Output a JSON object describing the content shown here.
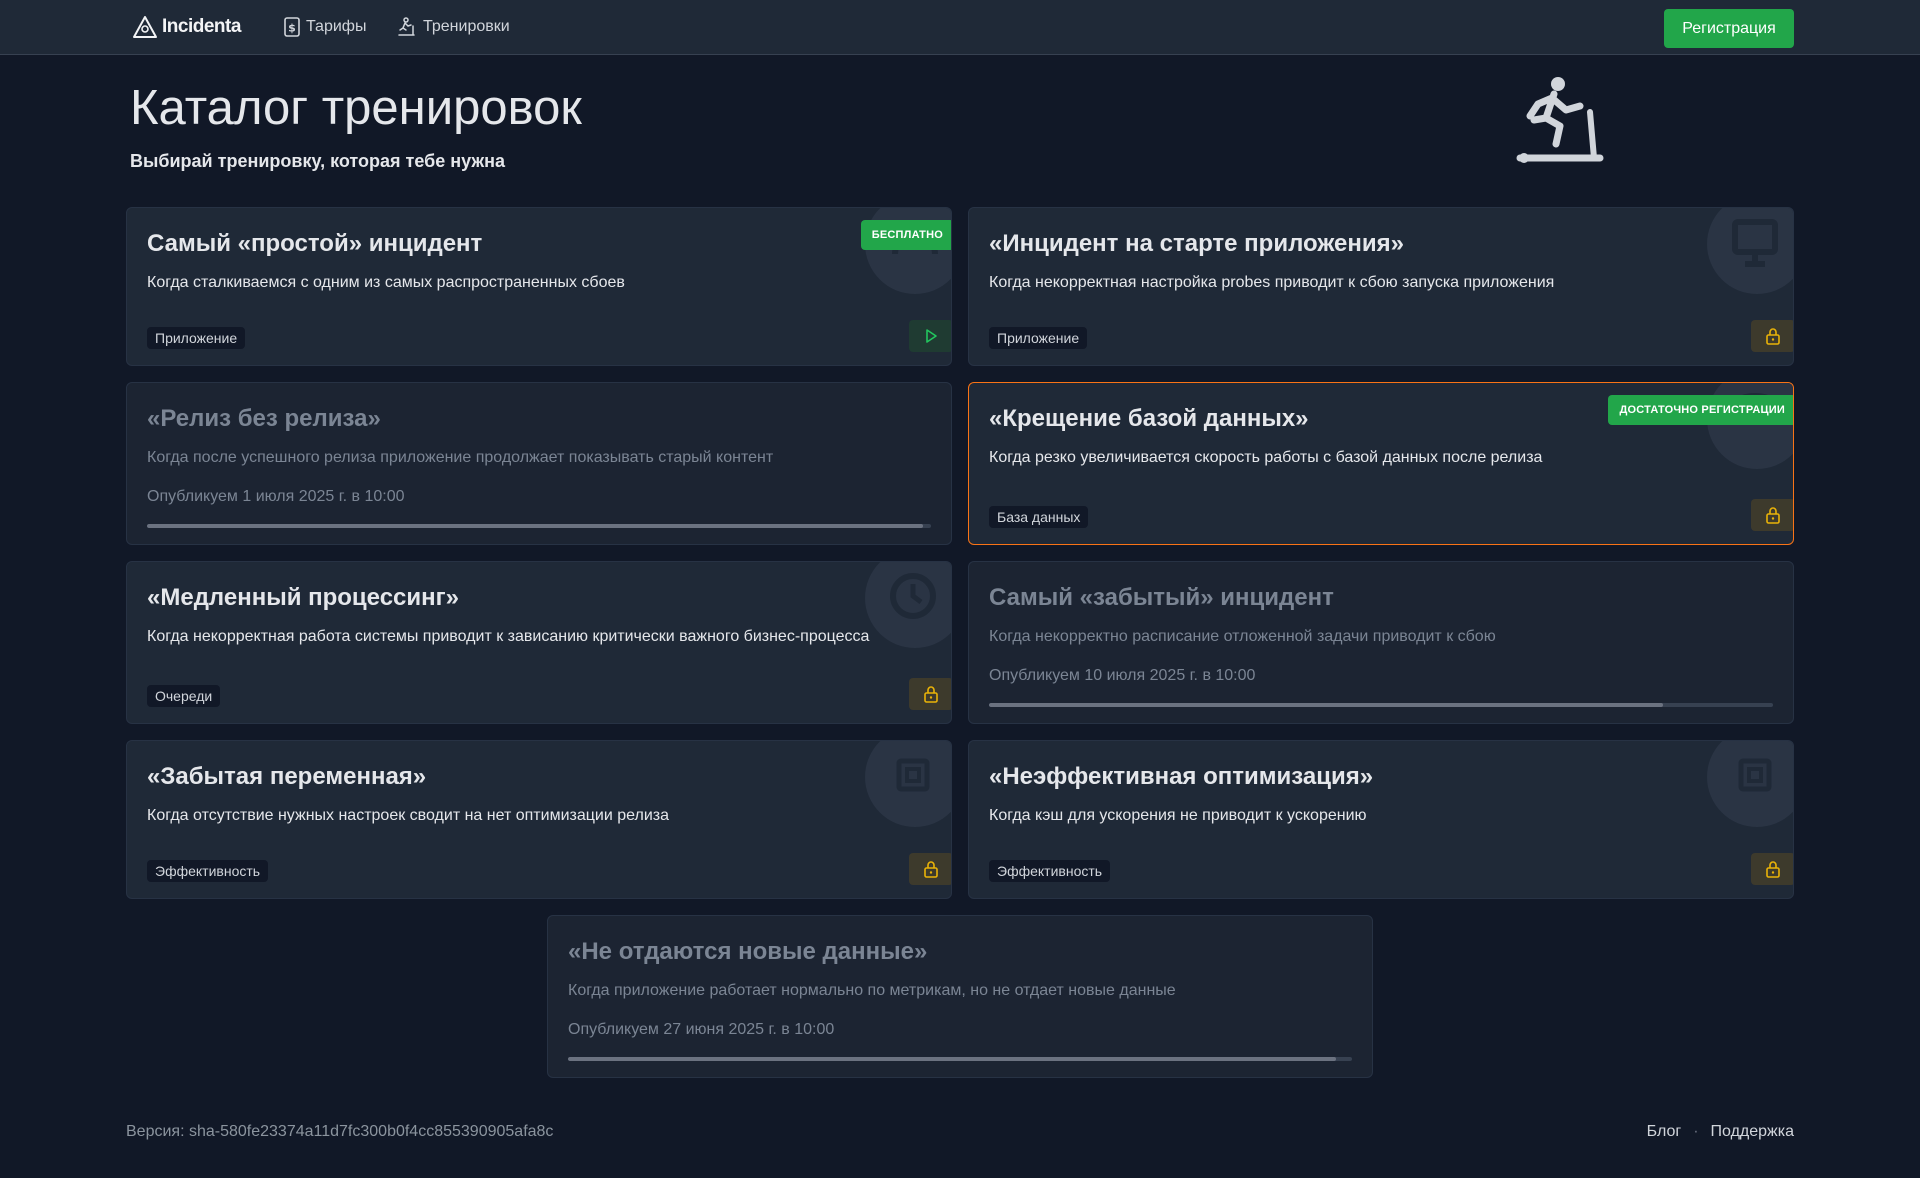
{
  "nav": {
    "logo": "Incidenta",
    "tariffs": "Тарифы",
    "trainings": "Тренировки",
    "register": "Регистрация"
  },
  "header": {
    "title": "Каталог тренировок",
    "subtitle": "Выбирай тренировку, которая тебе нужна"
  },
  "cards": [
    {
      "title": "Самый «простой» инцидент",
      "desc": "Когда сталкиваемся с одним из самых распространенных сбоев",
      "tag": "Приложение",
      "badge": "БЕСПЛАТНО",
      "action": "play-icon",
      "bg_icon": "gauge-icon"
    },
    {
      "title": "«Инцидент на старте приложения»",
      "desc": "Когда некорректная настройка probes приводит к сбою запуска приложения",
      "tag": "Приложение",
      "action": "lock-icon",
      "bg_icon": "monitor-icon"
    },
    {
      "title": "«Релиз без релиза»",
      "desc": "Когда после успешного релиза приложение продолжает показывать старый контент",
      "date": "Опубликуем 1 июля 2025 г. в 10:00",
      "progress": 0.99
    },
    {
      "title": "«Крещение базой данных»",
      "desc": "Когда резко увеличивается скорость работы с базой данных после релиза",
      "tag": "База данных",
      "badge": "ДОСТАТОЧНО РЕГИСТРАЦИИ",
      "action": "lock-icon",
      "bg_icon": "database-icon"
    },
    {
      "title": "«Медленный процессинг»",
      "desc": "Когда некорректная работа системы приводит к зависанию критически важного бизнес-процесса",
      "tag": "Очереди",
      "action": "lock-icon",
      "bg_icon": "clock-gear-icon"
    },
    {
      "title": "Самый «забытый» инцидент",
      "desc": "Когда некорректно расписание отложенной задачи приводит к сбою",
      "date": "Опубликуем 10 июля 2025 г. в 10:00",
      "progress": 0.86
    },
    {
      "title": "«Забытая переменная»",
      "desc": "Когда отсутствие нужных настроек сводит на нет оптимизации релиза",
      "tag": "Эффективность",
      "action": "lock-icon",
      "bg_icon": "chip-icon"
    },
    {
      "title": "«Неэффективная оптимизация»",
      "desc": "Когда кэш для ускорения не приводит к ускорению",
      "tag": "Эффективность",
      "action": "lock-icon",
      "bg_icon": "chip-icon"
    },
    {
      "title": "«Не отдаются новые данные»",
      "desc": "Когда приложение работает нормально по метрикам, но не отдает новые данные",
      "date": "Опубликуем 27 июня 2025 г. в 10:00",
      "progress": 0.98
    }
  ],
  "footer": {
    "version": "Версия: sha-580fe23374a11d7fc300b0f4cc855390905afa8c",
    "blog": "Блог",
    "separator": "·",
    "support": "Поддержка"
  },
  "colors": {
    "background": "#111827",
    "card": "#1f2937",
    "accent_green": "#22a64a",
    "lock_yellow": "#eab308",
    "highlight_orange": "#f97316"
  }
}
